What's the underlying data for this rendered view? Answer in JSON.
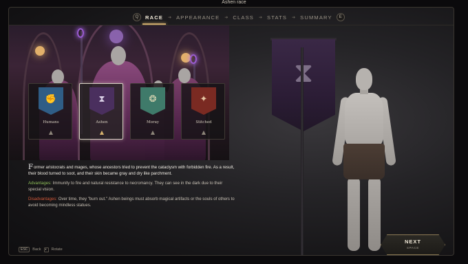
{
  "window": {
    "title": "Ashen race"
  },
  "nav": {
    "left_key": "Q",
    "right_key": "E",
    "steps": [
      {
        "label": "RACE",
        "active": true
      },
      {
        "label": "APPEARANCE",
        "active": false
      },
      {
        "label": "CLASS",
        "active": false
      },
      {
        "label": "STATS",
        "active": false
      },
      {
        "label": "SUMMARY",
        "active": false
      }
    ]
  },
  "races": [
    {
      "name": "Humans",
      "banner_color": "#2f5d86",
      "symbol": "✊",
      "selected": false
    },
    {
      "name": "Ashen",
      "banner_color": "#4a2f5e",
      "symbol": "⧗",
      "selected": true
    },
    {
      "name": "Moray",
      "banner_color": "#3f7a6a",
      "symbol": "❂",
      "selected": false
    },
    {
      "name": "Stitched",
      "banner_color": "#7a2a22",
      "symbol": "✦",
      "selected": false
    }
  ],
  "description": {
    "drop_cap": "F",
    "lore": "ormer aristocrats and mages, whose ancestors tried to prevent the cataclysm with forbidden fire. As a result, their blood turned to soot, and their skin became gray and dry like parchment.",
    "advantages_label": "Advantages:",
    "advantages_text": " Immunity to fire and natural resistance to necromancy. They can see in the dark due to their special vision.",
    "disadvantages_label": "Disadvantages:",
    "disadvantages_text": " Over time, they \"burn out.\" Ashen beings must absorb magical artifacts or the souls of others to avoid becoming mindless statues."
  },
  "footer": {
    "esc_key": "ESC",
    "back_label": "Back",
    "rotate_key": "◐",
    "rotate_label": "Rotate"
  },
  "next": {
    "label": "NEXT",
    "hint": "SPACE"
  },
  "colors": {
    "accent": "#c9a76b",
    "advantage": "#8fbf5a",
    "disadvantage": "#d45a3a"
  }
}
